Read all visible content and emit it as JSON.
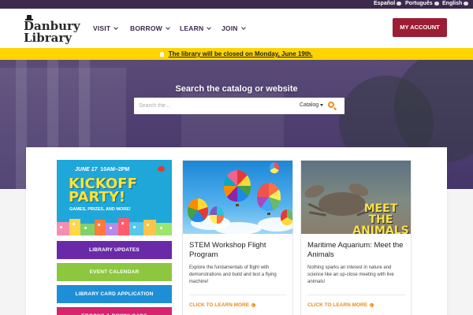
{
  "language_bar": {
    "items": [
      "Español",
      "Português",
      "English"
    ]
  },
  "header": {
    "logo_line1": "Danbury",
    "logo_line2": "Library",
    "nav": [
      {
        "label": "VISIT"
      },
      {
        "label": "BORROW"
      },
      {
        "label": "LEARN"
      },
      {
        "label": "JOIN"
      }
    ],
    "account_button": "MY ACCOUNT"
  },
  "alert": {
    "text": "The library will be closed on Monday, June 19th.",
    "icon": "lightbulb-icon"
  },
  "search": {
    "title": "Search the catalog or website",
    "placeholder": "Search the...",
    "scope": "Catalog",
    "icon": "search-icon"
  },
  "promo": {
    "date": "JUNE 17",
    "time": "10AM–2PM",
    "headline": "KICKOFF PARTY!",
    "subline": "GAMES, PRIZES, AND MORE!"
  },
  "side_buttons": [
    {
      "label": "LIBRARY UPDATES",
      "color": "#6a2aa8"
    },
    {
      "label": "EVENT CALENDAR",
      "color": "#8dc63f"
    },
    {
      "label": "LIBRARY CARD APPLICATION",
      "color": "#1e8fd6"
    },
    {
      "label": "EBOOKS & DOWNLOADS",
      "color": "#d6246e"
    }
  ],
  "cards": [
    {
      "title": "STEM Workshop Flight Program",
      "description": "Explore the fundamentals of flight with demonstrations and build and test a flying machine!",
      "link": "CLICK TO LEARN MORE"
    },
    {
      "title": "Maritime Aquarium: Meet the Animals",
      "description": "Nothing sparks an interest in nature and science like an up-close meeting with live animals!",
      "image_text": "MEET THE ANIMALS",
      "link": "CLICK TO LEARN MORE"
    }
  ],
  "colors": {
    "brand_purple": "#3b2a4e",
    "account_red": "#9c1e34",
    "alert_yellow": "#ffd400",
    "link_orange": "#f08a1c"
  }
}
